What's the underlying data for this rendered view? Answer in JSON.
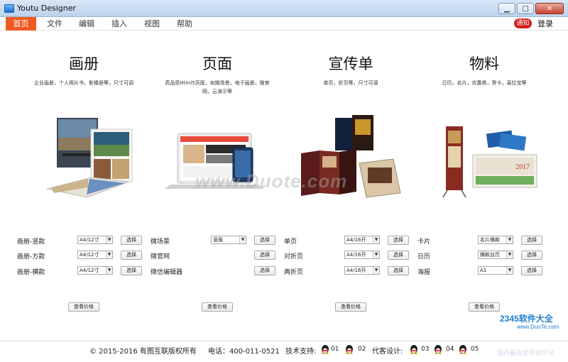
{
  "window": {
    "title": "Youtu Designer",
    "min": "▁",
    "max": "□",
    "close": "✕"
  },
  "menu": {
    "items": [
      "首页",
      "文件",
      "编辑",
      "插入",
      "视图",
      "帮助"
    ],
    "notice": "通知",
    "login": "登录"
  },
  "sections": [
    {
      "title": "画册",
      "subtitle": "企业画册，个人照片书，影楼册等，尺寸可调",
      "options": [
        {
          "label": "画册-竖款",
          "select": "A4/12寸",
          "button": "选择"
        },
        {
          "label": "画册-方款",
          "select": "A4/12寸",
          "button": "选择"
        },
        {
          "label": "画册-横款",
          "select": "A4/12寸",
          "button": "选择"
        }
      ],
      "price_button": "查看价格"
    },
    {
      "title": "页面",
      "subtitle": "高品质Html5页面，如微场景，电子画册，微官网，云演示等",
      "options": [
        {
          "label": "微场景",
          "select": "竖版",
          "button": "选择"
        },
        {
          "label": "微官网",
          "select": "",
          "button": "选择"
        },
        {
          "label": "微信编辑器",
          "select": "",
          "button": "选择"
        }
      ],
      "price_button": "查看价格"
    },
    {
      "title": "宣传单",
      "subtitle": "单页，折页等，尺寸可调",
      "options": [
        {
          "label": "单页",
          "select": "A4/16开",
          "button": "选择"
        },
        {
          "label": "对折页",
          "select": "A4/16开",
          "button": "选择"
        },
        {
          "label": "两折页",
          "select": "A4/16开",
          "button": "选择"
        }
      ],
      "price_button": "查看价格"
    },
    {
      "title": "物料",
      "subtitle": "日历，名片，优惠券，贺卡，易拉宝等",
      "options": [
        {
          "label": "卡片",
          "select": "名片横款",
          "button": "选择"
        },
        {
          "label": "日历",
          "select": "横款台历",
          "button": "选择"
        },
        {
          "label": "海报",
          "select": "A1",
          "button": "选择"
        }
      ],
      "price_button": "查看价格"
    }
  ],
  "footer": {
    "copyright": "© 2015-2016 有图互联版权所有",
    "phone": "电话：400-011-0521",
    "support_label": "技术支持:",
    "support_nums": [
      "01",
      "02"
    ],
    "design_label": "代客设计:",
    "design_nums": [
      "03",
      "04",
      "05"
    ]
  },
  "watermarks": {
    "center": "www.Duote.com",
    "logo": "2345软件大全",
    "logo_sub": "www.DuoTe.com",
    "bottom": "国内最安全的软件站"
  },
  "calendar_year": "2017"
}
